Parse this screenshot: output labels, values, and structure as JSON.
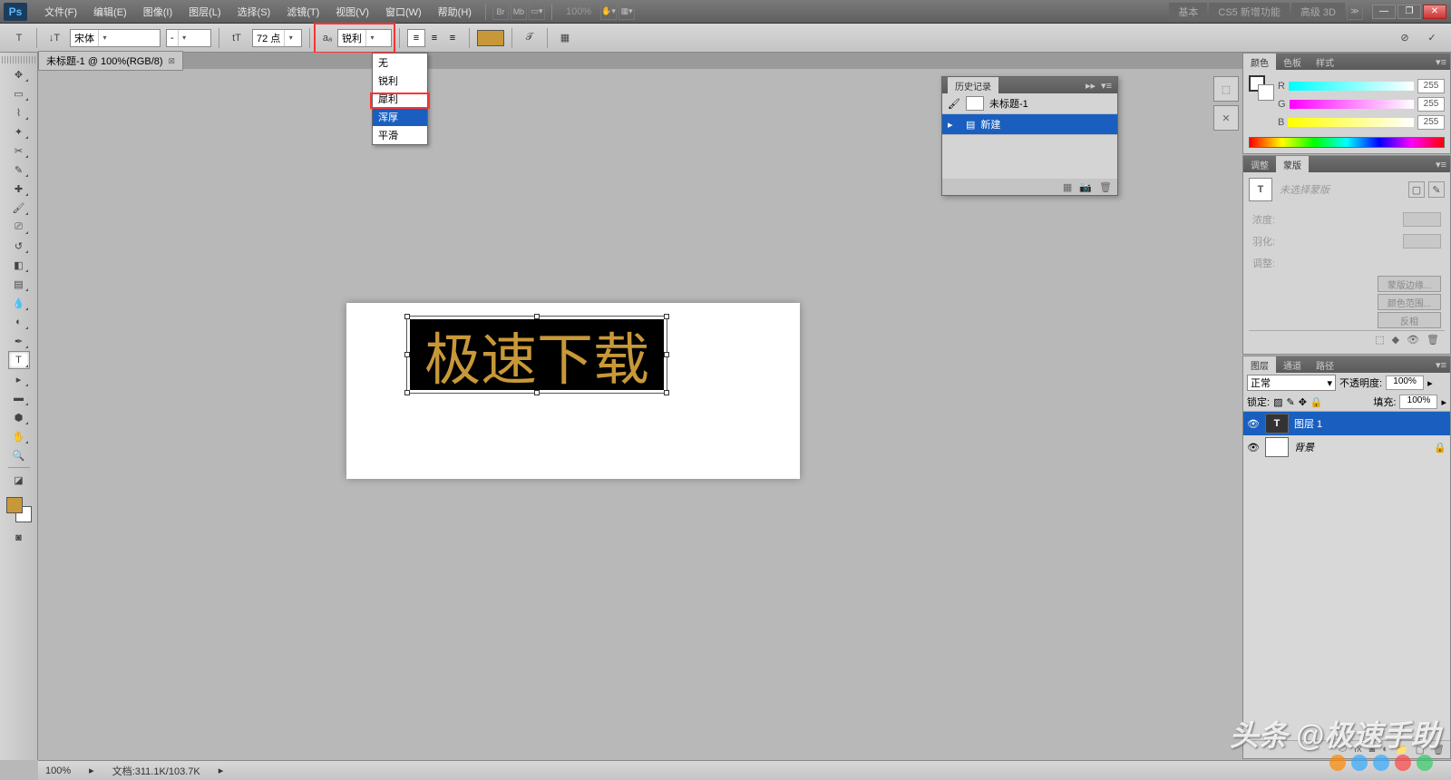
{
  "menubar": {
    "items": [
      "文件(F)",
      "编辑(E)",
      "图像(I)",
      "图层(L)",
      "选择(S)",
      "滤镜(T)",
      "视图(V)",
      "窗口(W)",
      "帮助(H)"
    ],
    "zoom": "100%",
    "workspaces": [
      "基本",
      "CS5 新增功能",
      "高级 3D"
    ]
  },
  "options": {
    "font_family": "宋体",
    "font_style": "-",
    "font_size": "72 点",
    "aa_label": "锐利",
    "aa_icon": "aₐ"
  },
  "dropdown": {
    "items": [
      "无",
      "锐利",
      "犀利",
      "浑厚",
      "平滑"
    ],
    "selected_index": 3
  },
  "doc_tab": "未标题-1 @ 100%(RGB/8)",
  "canvas_text": "极速下载",
  "status": {
    "zoom": "100%",
    "info": "文档:311.1K/103.7K"
  },
  "history": {
    "title": "历史记录",
    "doc": "未标题-1",
    "entries": [
      "新建"
    ]
  },
  "color": {
    "tabs": [
      "颜色",
      "色板",
      "样式"
    ],
    "r": "255",
    "g": "255",
    "b": "255",
    "rlabel": "R",
    "glabel": "G",
    "blabel": "B"
  },
  "mask": {
    "tabs": [
      "调整",
      "蒙版"
    ],
    "placeholder": "未选择蒙版",
    "density": "浓度:",
    "feather": "羽化:",
    "adjust": "调整:",
    "btns": [
      "蒙版边缘...",
      "颜色范围...",
      "反相"
    ]
  },
  "layers": {
    "tabs": [
      "图层",
      "通道",
      "路径"
    ],
    "blend": "正常",
    "opacity_label": "不透明度:",
    "opacity": "100%",
    "lock": "锁定:",
    "fill_label": "填充:",
    "fill": "100%",
    "items": [
      {
        "name": "图层 1",
        "type": "T",
        "sel": true
      },
      {
        "name": "背景",
        "type": "bg",
        "locked": true
      }
    ]
  },
  "watermark": "头条 @极速手助",
  "tools": [
    "move",
    "marquee",
    "lasso",
    "wand",
    "crop",
    "eyedrop",
    "heal",
    "brush",
    "stamp",
    "history-brush",
    "eraser",
    "gradient",
    "blur",
    "dodge",
    "pen",
    "type",
    "path-sel",
    "shape",
    "3d",
    "hand",
    "zoom",
    "fgbg-swap"
  ]
}
